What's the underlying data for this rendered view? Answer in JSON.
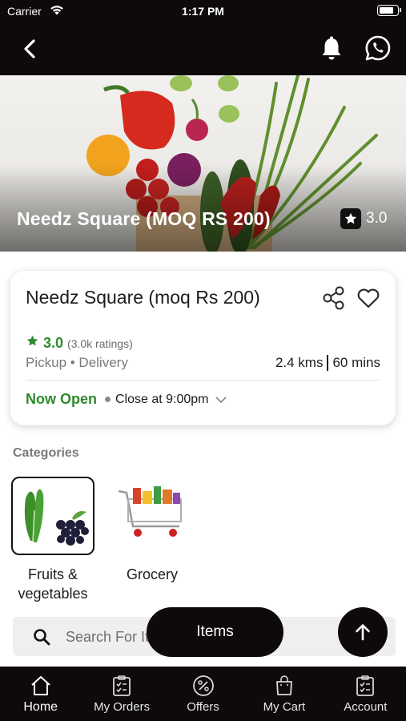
{
  "status_bar": {
    "carrier": "Carrier",
    "time": "1:17 PM",
    "battery_level": 0.85
  },
  "nav": {
    "back_icon": "chevron-left-icon",
    "notification_icon": "bell-icon",
    "whatsapp_icon": "whatsapp-icon"
  },
  "hero": {
    "title": "Needz Square (MOQ RS 200)",
    "rating": "3.0",
    "rating_icon": "star-icon"
  },
  "store": {
    "name": "Needz Square (moq Rs 200)",
    "rating": "3.0",
    "rating_count": "(3.0k ratings)",
    "modes": "Pickup • Delivery",
    "distance": "2.4 kms",
    "time": "60 mins",
    "status": "Now Open",
    "closing": "Close at 9:00pm"
  },
  "categories": {
    "title": "Categories",
    "items": [
      {
        "label": "Fruits & vegetables",
        "selected": true
      },
      {
        "label": "Grocery",
        "selected": false
      }
    ]
  },
  "search": {
    "placeholder": "Search For Items"
  },
  "items_button": {
    "label": "Items"
  },
  "colors": {
    "accent": "#0e0a0a",
    "open_green": "#2e8a2e",
    "muted": "#7a7a7a"
  },
  "tabs": [
    {
      "label": "Home",
      "icon": "home-icon",
      "active": true
    },
    {
      "label": "My Orders",
      "icon": "orders-clipboard-icon",
      "active": false
    },
    {
      "label": "Offers",
      "icon": "percent-badge-icon",
      "active": false
    },
    {
      "label": "My Cart",
      "icon": "shopping-bag-icon",
      "active": false
    },
    {
      "label": "Account",
      "icon": "account-clipboard-icon",
      "active": false
    }
  ]
}
